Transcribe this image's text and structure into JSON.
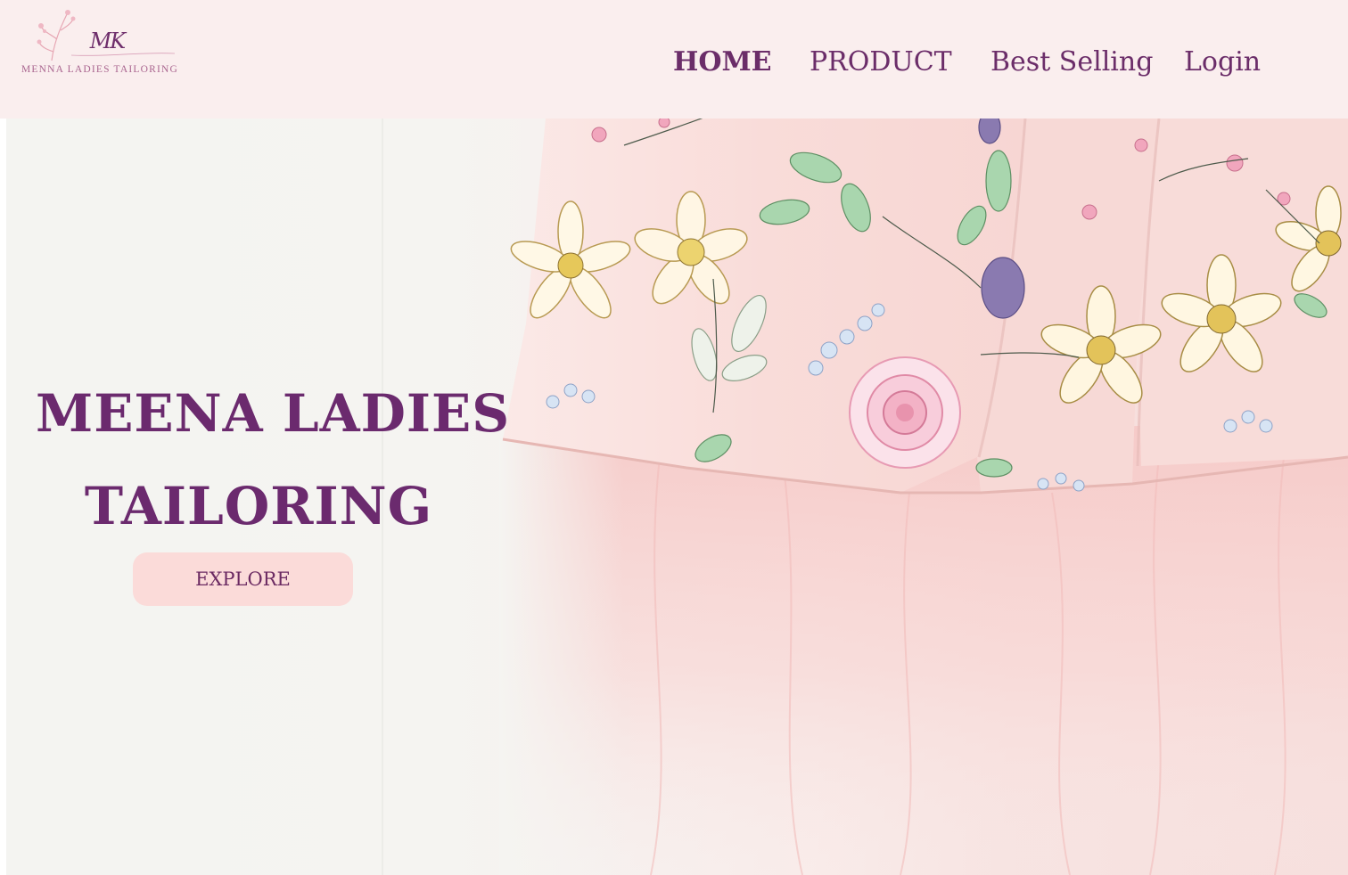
{
  "brand": {
    "monogram": "MK",
    "name": "MENNA LADIES TAILORING"
  },
  "nav": {
    "items": [
      {
        "label": "HOME",
        "active": true
      },
      {
        "label": "PRODUCT",
        "active": false
      },
      {
        "label": "Best Selling",
        "active": false
      },
      {
        "label": "Login",
        "active": false
      }
    ]
  },
  "hero": {
    "title_line1": "MEENA LADIES",
    "title_line2": "TAILORING",
    "cta_label": "EXPLORE"
  },
  "colors": {
    "header_bg": "#faeeee",
    "brand_purple": "#6b2a6e",
    "button_bg": "#fbdbd9",
    "dress_pink": "#f6c8c6"
  }
}
